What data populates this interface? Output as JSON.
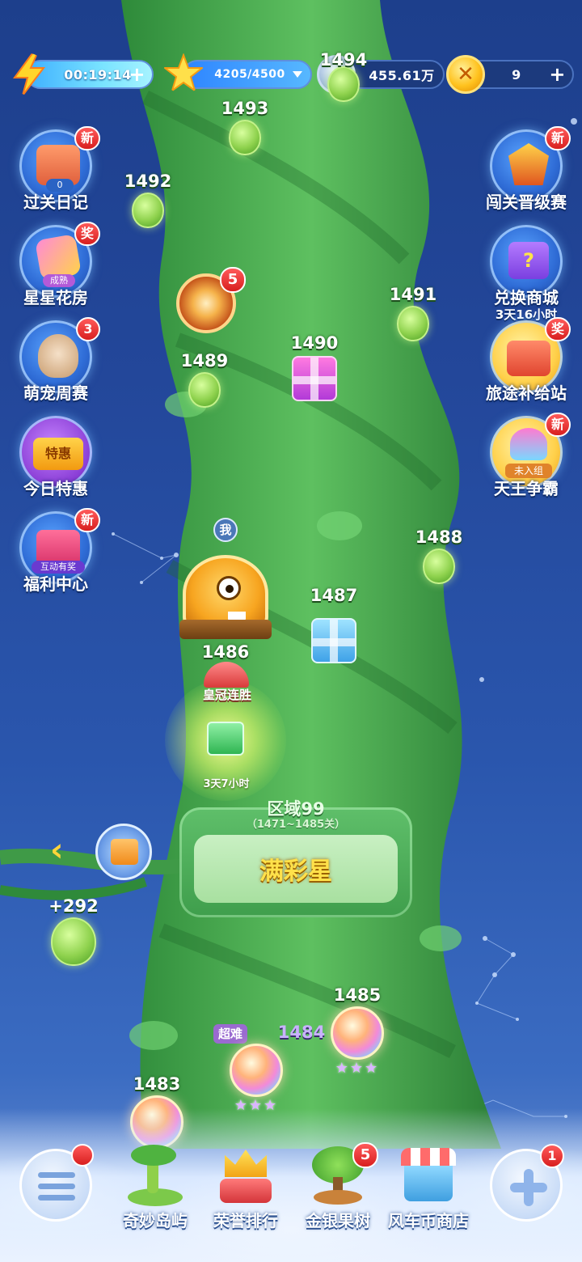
{
  "topbar": {
    "energy_time": "00:19:14",
    "stars": "4205/4500",
    "silver": "455.61万",
    "gold": "9",
    "plus": "+"
  },
  "left_buttons": [
    {
      "label": "过关日记",
      "badge": "新",
      "counter": "0"
    },
    {
      "label": "星星花房",
      "badge": "奖",
      "tag": "成熟"
    },
    {
      "label": "萌宠周赛",
      "badge": "3"
    },
    {
      "label": "今日特惠",
      "tag": "特惠"
    },
    {
      "label": "福利中心",
      "badge": "新",
      "tag": "互动有奖"
    }
  ],
  "right_buttons": [
    {
      "label": "闯关晋级赛",
      "badge": "新"
    },
    {
      "label": "兑换商城",
      "sub": "3天16小时"
    },
    {
      "label": "旅途补给站",
      "badge": "奖"
    },
    {
      "label": "天王争霸",
      "badge": "新",
      "tag": "未入组"
    }
  ],
  "levels": {
    "l1494": "1494",
    "l1493": "1493",
    "l1492": "1492",
    "l1491": "1491",
    "l1490": "1490",
    "l1489": "1489",
    "l1488": "1488",
    "l1487": "1487",
    "l1486": "1486",
    "l1485": "1485",
    "l1484": "1484",
    "l1483": "1483",
    "hard_tag": "超难"
  },
  "wheel_badge": "5",
  "me_tag": "我",
  "streak": {
    "label": "皇冠连胜",
    "time": "3天7小时"
  },
  "zone": {
    "title": "区域99",
    "range": "（1471~1485关）",
    "name": "满彩星"
  },
  "bonus": "+292",
  "bottom_nav": [
    {
      "label": "奇妙岛屿"
    },
    {
      "label": "荣誉排行"
    },
    {
      "label": "金银果树",
      "badge": "5"
    },
    {
      "label": "风车币商店"
    }
  ],
  "menu_badge": "",
  "plus_badge": "1",
  "colors": {
    "accent": "#ffd53a",
    "badge": "#e02a2a",
    "stalk": "#3e9e4a"
  }
}
